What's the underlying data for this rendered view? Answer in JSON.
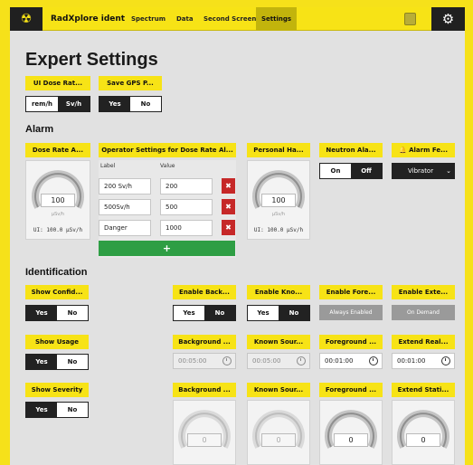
{
  "app": {
    "name": "RadXplore ident"
  },
  "nav": {
    "items": [
      "Spectrum",
      "Data",
      "Second Screen",
      "Settings"
    ],
    "active": "Settings"
  },
  "page": {
    "title": "Expert Settings"
  },
  "general": {
    "ui_dose_rate": {
      "label": "UI Dose Rat...",
      "options": [
        "rem/h",
        "Sv/h"
      ],
      "selected": "Sv/h"
    },
    "save_gps": {
      "label": "Save GPS P...",
      "options": [
        "Yes",
        "No"
      ],
      "selected": "Yes"
    }
  },
  "alarm": {
    "title": "Alarm",
    "dose_rate": {
      "label": "Dose Rate A...",
      "value": "100",
      "unit": "µSv/h",
      "ui_text": "UI: 100.0 µSv/h"
    },
    "operator": {
      "label": "Operator Settings for Dose Rate Al...",
      "col_label": "Label",
      "col_value": "Value",
      "rows": [
        {
          "label": "200 Sv/h",
          "value": "200"
        },
        {
          "label": "500Sv/h",
          "value": "500"
        },
        {
          "label": "Danger",
          "value": "1000"
        }
      ],
      "add": "+"
    },
    "personal": {
      "label": "Personal Ha...",
      "value": "100",
      "unit": "µSv/h",
      "ui_text": "UI: 100.0 µSv/h"
    },
    "neutron": {
      "label": "Neutron Ala...",
      "options": [
        "On",
        "Off"
      ],
      "selected": "Off"
    },
    "alarm_feedback": {
      "label": "Alarm Fe...",
      "value": "Vibrator"
    }
  },
  "identification": {
    "title": "Identification",
    "show_confidence": {
      "label": "Show Confid...",
      "options": [
        "Yes",
        "No"
      ],
      "selected": "Yes"
    },
    "show_usage": {
      "label": "Show Usage",
      "options": [
        "Yes",
        "No"
      ],
      "selected": "Yes"
    },
    "show_severity": {
      "label": "Show Severity",
      "options": [
        "Yes",
        "No"
      ],
      "selected": "Yes"
    },
    "enable_background": {
      "label": "Enable Back...",
      "options": [
        "Yes",
        "No"
      ],
      "selected": "No"
    },
    "enable_known": {
      "label": "Enable Kno...",
      "options": [
        "Yes",
        "No"
      ],
      "selected": "No"
    },
    "enable_foreground": {
      "label": "Enable Fore...",
      "state": "Always Enabled"
    },
    "enable_extended": {
      "label": "Enable Exte...",
      "state": "On Demand"
    },
    "background_time": {
      "label": "Background ...",
      "value": "00:05:00"
    },
    "known_time": {
      "label": "Known Sour...",
      "value": "00:05:00"
    },
    "foreground_time": {
      "label": "Foreground ...",
      "value": "00:01:00"
    },
    "extend_real_time": {
      "label": "Extend Real...",
      "value": "00:01:00"
    },
    "background_gauge": {
      "label": "Background ...",
      "value": "0"
    },
    "known_gauge": {
      "label": "Known Sour...",
      "value": "0"
    },
    "foreground_gauge": {
      "label": "Foreground ...",
      "value": "0"
    },
    "extend_static_gauge": {
      "label": "Extend Stati...",
      "value": "0"
    }
  },
  "icons": {
    "logo": "radiation-icon",
    "book": "book-icon",
    "settings": "gear-icon",
    "bell": "bell-icon",
    "clock": "clock-icon",
    "delete": "close-icon",
    "chevron": "chevron-down-icon"
  },
  "colors": {
    "accent": "#f7e316",
    "dark": "#222222",
    "delete": "#c62828",
    "add": "#2e9e44",
    "disabled": "#9a9a9a"
  }
}
